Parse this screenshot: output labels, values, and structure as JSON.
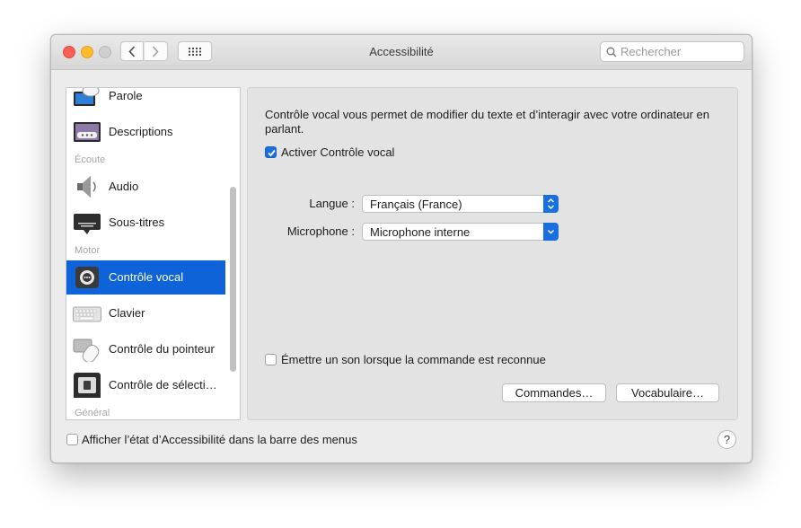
{
  "window": {
    "title": "Accessibilité"
  },
  "search": {
    "placeholder": "Rechercher"
  },
  "sidebar": {
    "items": [
      {
        "label": "Parole",
        "icon": "display-speech-icon"
      },
      {
        "label": "Descriptions",
        "icon": "descriptions-icon"
      },
      {
        "label": "Audio",
        "icon": "speaker-icon"
      },
      {
        "label": "Sous-titres",
        "icon": "subtitles-icon"
      },
      {
        "label": "Contrôle vocal",
        "icon": "voice-control-icon",
        "selected": true
      },
      {
        "label": "Clavier",
        "icon": "keyboard-icon"
      },
      {
        "label": "Contrôle du pointeur",
        "icon": "pointer-control-icon"
      },
      {
        "label": "Contrôle de sélecti…",
        "icon": "switch-control-icon"
      }
    ],
    "headers": {
      "ecoute": "Écoute",
      "motor": "Motor",
      "general": "Général"
    }
  },
  "panel": {
    "description": "Contrôle vocal vous permet de modifier du texte et d’interagir avec votre ordinateur en parlant.",
    "enable_label": "Activer Contrôle vocal",
    "enable_checked": true,
    "language_label": "Langue :",
    "language_value": "Français (France)",
    "microphone_label": "Microphone :",
    "microphone_value": "Microphone interne",
    "sound_label": "Émettre un son lorsque la commande est reconnue",
    "sound_checked": false,
    "commands_button": "Commandes…",
    "vocabulary_button": "Vocabulaire…"
  },
  "footer": {
    "menu_status_label": "Afficher l’état d’Accessibilité dans la barre des menus",
    "menu_status_checked": false,
    "help_label": "?"
  },
  "colors": {
    "accent": "#1a6fe0",
    "selection": "#0e63d8"
  }
}
